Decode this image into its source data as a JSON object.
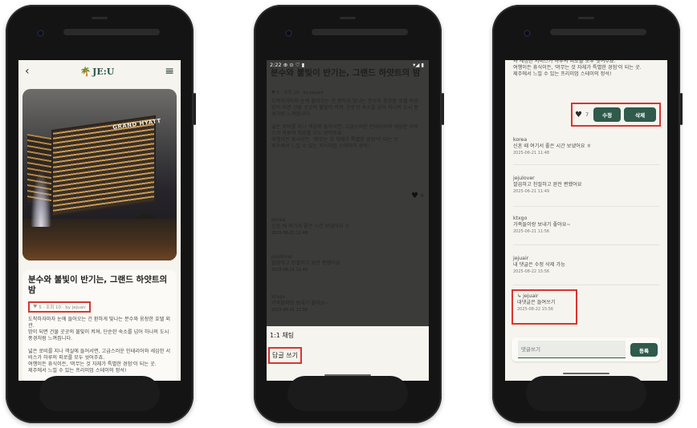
{
  "phone1": {
    "header": {
      "back": "‹",
      "logo": "JE:U",
      "menu": "≡"
    },
    "hero": {
      "sign": "GRAND HYATT"
    },
    "post": {
      "title": "분수와 불빛이 반기는, 그랜드 하얏트의 밤",
      "meta": "5 · 조회 10 · by jejuair",
      "body": "도착하자마자 눈에 들어오는 건 환하게 빛나는 분수와 웅장한 호텔 외관.\n밤이 되면 건물 곳곳의 불빛이 켜져, 단순한 숙소를 넘어 하나의 도시 풍경처럼 느껴집니다.\n\n넓은 로비를 지나 객실에 들어서면, 고급스러운 인테리어와 세심한 서비스가 하루의 피로를 모두 씻어주죠.\n여행이든 휴식이든, '머무는 것 자체가 특별한 경험'이 되는 곳.\n제주에서 느낄 수 있는 프리미엄 스테이의 정석!"
    }
  },
  "phone2": {
    "status": {
      "time": "2:22",
      "icons": "⊕ ⊙ ♡ ▮",
      "right": "▾◢ ▮"
    },
    "title": "분수와 불빛이 반기는, 그랜드 하얏트의 밤",
    "meta": "♥ 5 · 조회 10 · by jejuair",
    "body": "도착하자마자 눈에 들어오는 건 환하게 빛나는 분수와 웅장한 호텔 외관.\n밤이 되면 건물 곳곳의 불빛이 켜져, 단순한 숙소를 넘어 하나의 도시 풍경처럼 느껴집니다.\n\n넓은 로비를 지나 객실에 들어서면, 고급스러운 인테리어와 세심한 서비스가 하루의 피로를 모두 씻어주죠.\n여행이든 휴식이든, '머무는 것 자체가 특별한 경험'이 되는 곳.\n제주에서 느낄 수 있는 프리미엄 스테이의 정석!",
    "like_count": "6",
    "comments": [
      {
        "user": "korea",
        "text": "신혼 때 여기서 좋은 시간 보냈어요 ㅎ",
        "date": "2025-06-21 11:48"
      },
      {
        "user": "jejulover",
        "text": "깔끔하고 친절하고 완전 편했어요",
        "date": "2025-06-21 11:49"
      },
      {
        "user": "ktxgo",
        "text": "가족들이랑 보내기 좋아요~",
        "date": "2025-06-21 11:56"
      }
    ],
    "sheet": {
      "option1": "1:1 채팅",
      "option2": "답글 쓰기"
    }
  },
  "phone3": {
    "body": "와 세심한 서비스가 하루의 피로를 모두 씻어주죠.\n여행이든 휴식이든, '머무는 것 자체가 특별한 경험'이 되는 곳.\n제주에서 느낄 수 있는 프리미엄 스테이의 정석!",
    "like_count": "7",
    "edit_label": "수정",
    "delete_label": "삭제",
    "comments": [
      {
        "user": "korea",
        "text": "신혼 때 여기서 좋은 시간 보냈어요 ㅎ",
        "date": "2025-06-21 11:48"
      },
      {
        "user": "jejulover",
        "text": "깔끔하고 친절하고 완전 편했어요",
        "date": "2025-06-21 11:49"
      },
      {
        "user": "ktxgo",
        "text": "가족들이랑 보내기 좋아요~",
        "date": "2025-06-21 11:56"
      },
      {
        "user": "jejuair",
        "text": "내 댓글은 수정 삭제 가능",
        "date": "2025-08-22 15:56"
      }
    ],
    "reply": {
      "prefix": "↳",
      "user": "jejuair",
      "text": "대댓글은 들여쓰기",
      "date": "2025-08-22 15:56"
    },
    "input_placeholder": "댓글쓰기",
    "register_label": "등록"
  },
  "colors": {
    "accent": "#2f5a4c",
    "highlight": "#d9352f",
    "background": "#f6f4ee"
  }
}
